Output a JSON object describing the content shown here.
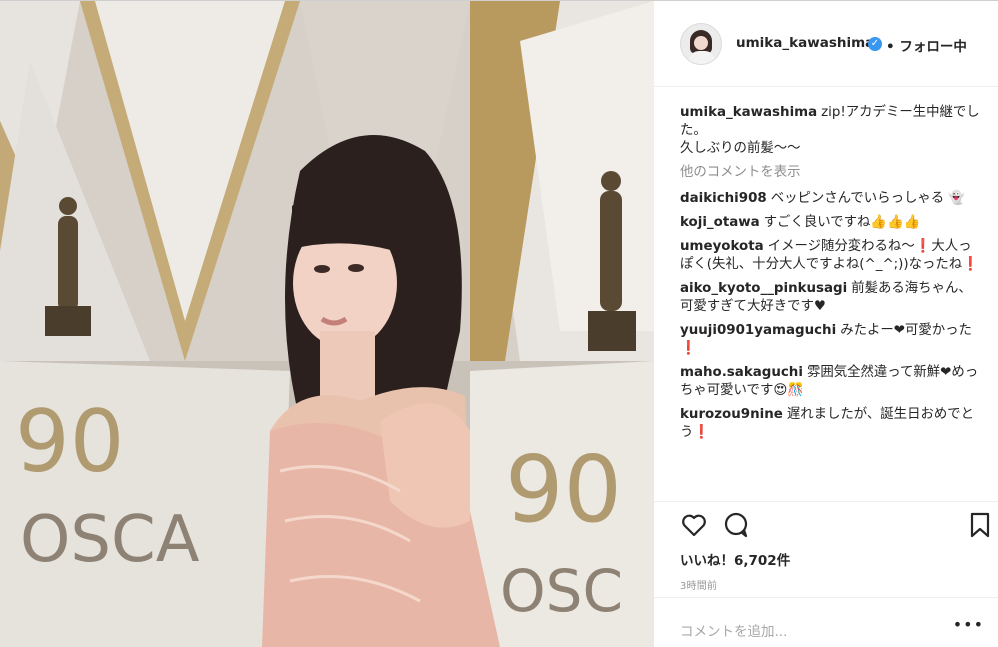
{
  "header": {
    "username": "umika_kawashima",
    "verified_icon": "verified-badge-icon",
    "follow_label": "• フォロー中"
  },
  "caption": {
    "username": "umika_kawashima",
    "text": "zip!アカデミー生中継でした。\n久しぶりの前髪〜〜"
  },
  "more_comments_label": "他のコメントを表示",
  "comments": [
    {
      "user": "daikichi908",
      "text": "ベッピンさんでいらっしゃる 👻"
    },
    {
      "user": "koji_otawa",
      "text": "すごく良いですね👍👍👍"
    },
    {
      "user": "umeyokota",
      "text": "イメージ随分変わるね〜❗大人っぽく(失礼、十分大人ですよね(^_^;))なったね❗"
    },
    {
      "user": "aiko_kyoto__pinkusagi",
      "text": "前髪ある海ちゃん、可愛すぎて大好きです♥"
    },
    {
      "user": "yuuji0901yamaguchi",
      "text": "みたよー❤可愛かった❗"
    },
    {
      "user": "maho.sakaguchi",
      "text": "雰囲気全然違って新鮮❤めっちゃ可愛いです😍🎊"
    },
    {
      "user": "kurozou9nine",
      "text": "遅れましたが、誕生日おめでとう❗"
    }
  ],
  "actions": {
    "like_icon": "heart-icon",
    "comment_icon": "comment-bubble-icon",
    "save_icon": "bookmark-icon"
  },
  "likes_label": "いいね！6,702件",
  "time_label": "3時間前",
  "add_comment_placeholder": "コメントを追加...",
  "more_icon": "more-options-icon",
  "colors": {
    "accent": "#3897f0",
    "text": "#262626",
    "muted": "#8e8e8e"
  }
}
